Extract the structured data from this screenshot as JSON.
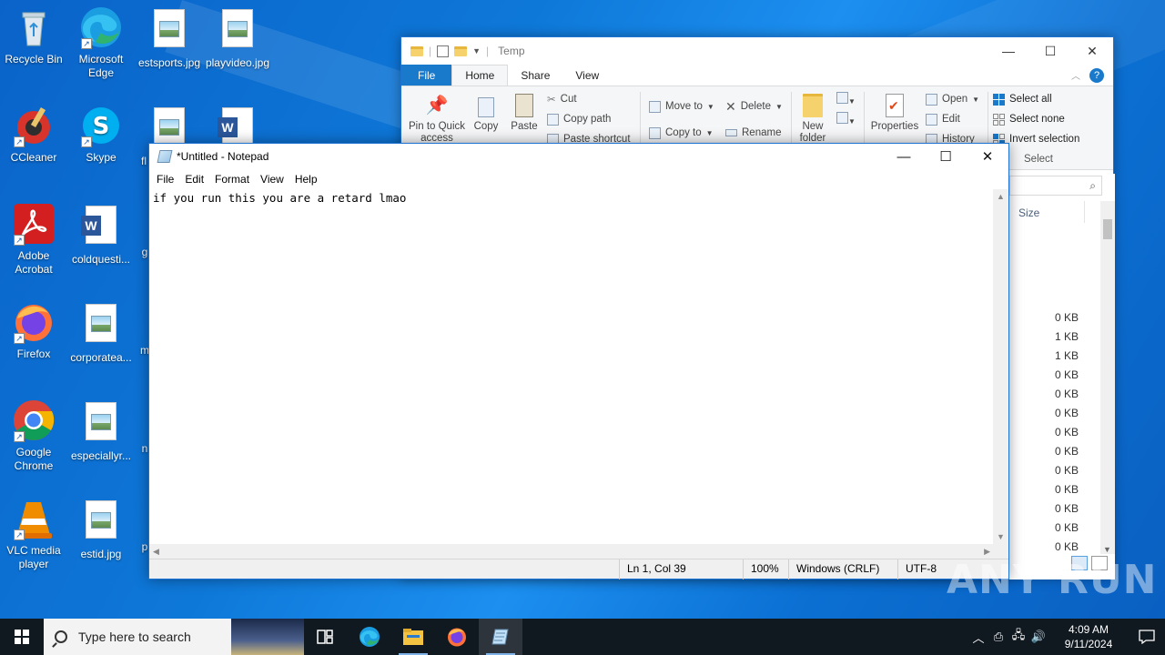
{
  "desktop": {
    "icons": [
      {
        "label": "Recycle Bin"
      },
      {
        "label": "Microsoft Edge"
      },
      {
        "label": "estsports.jpg"
      },
      {
        "label": "playvideo.jpg"
      },
      {
        "label": "CCleaner"
      },
      {
        "label": "Skype"
      },
      {
        "label": "fl"
      },
      {
        "label": "Adobe Acrobat"
      },
      {
        "label": "coldquesti..."
      },
      {
        "label": "g"
      },
      {
        "label": "Firefox"
      },
      {
        "label": "corporatea..."
      },
      {
        "label": "m"
      },
      {
        "label": "Google Chrome"
      },
      {
        "label": "especiallyr..."
      },
      {
        "label": "n"
      },
      {
        "label": "VLC media player"
      },
      {
        "label": "estid.jpg"
      },
      {
        "label": "p"
      }
    ]
  },
  "explorer": {
    "title": "Temp",
    "tabs": [
      "File",
      "Home",
      "Share",
      "View"
    ],
    "ribbon": {
      "pin": "Pin to Quick access",
      "copy": "Copy",
      "paste": "Paste",
      "cut": "Cut",
      "copy_path": "Copy path",
      "paste_shortcut": "Paste shortcut",
      "move_to": "Move to",
      "copy_to": "Copy to",
      "delete": "Delete",
      "rename": "Rename",
      "new_folder": "New folder",
      "properties": "Properties",
      "open": "Open",
      "edit": "Edit",
      "history": "History",
      "select_all": "Select all",
      "select_none": "Select none",
      "invert_selection": "Invert selection",
      "select_group": "Select"
    },
    "column_size": "Size",
    "sizes": [
      "0 KB",
      "1 KB",
      "1 KB",
      "0 KB",
      "0 KB",
      "0 KB",
      "0 KB",
      "0 KB",
      "0 KB",
      "0 KB",
      "0 KB",
      "0 KB",
      "0 KB"
    ]
  },
  "notepad": {
    "title": "*Untitled - Notepad",
    "menu": [
      "File",
      "Edit",
      "Format",
      "View",
      "Help"
    ],
    "content": "if you run this you are a retard lmao",
    "status": {
      "position": "Ln 1, Col 39",
      "zoom": "100%",
      "line_ending": "Windows (CRLF)",
      "encoding": "UTF-8"
    }
  },
  "taskbar": {
    "search_placeholder": "Type here to search",
    "time": "4:09 AM",
    "date": "9/11/2024"
  },
  "watermark": "ANY RUN"
}
